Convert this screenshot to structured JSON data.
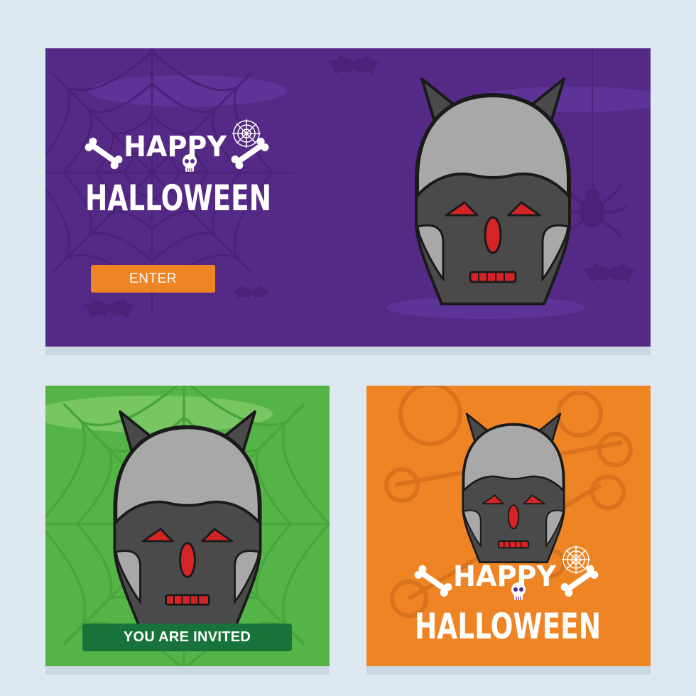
{
  "banner": {
    "greeting_line1": "HAPPY",
    "greeting_line2": "HALLOWEEN",
    "enter_label": "ENTER"
  },
  "green_card": {
    "invite_label": "YOU ARE INVITED"
  },
  "orange_card": {
    "greeting_line1": "HAPPY",
    "greeting_line2": "HALLOWEEN"
  },
  "icons": [
    "spider-web-icon",
    "bone-icon",
    "skull-icon",
    "devil-mask-icon",
    "bat-icon",
    "spider-icon"
  ],
  "colors": {
    "background": "#dde8f0",
    "purple": "#552a86",
    "green": "#55b448",
    "orange": "#ee8423",
    "dark_green": "#17733a",
    "mask_dark": "#4a4a4a",
    "mask_light": "#a8a8a8",
    "mask_red": "#d42426"
  }
}
